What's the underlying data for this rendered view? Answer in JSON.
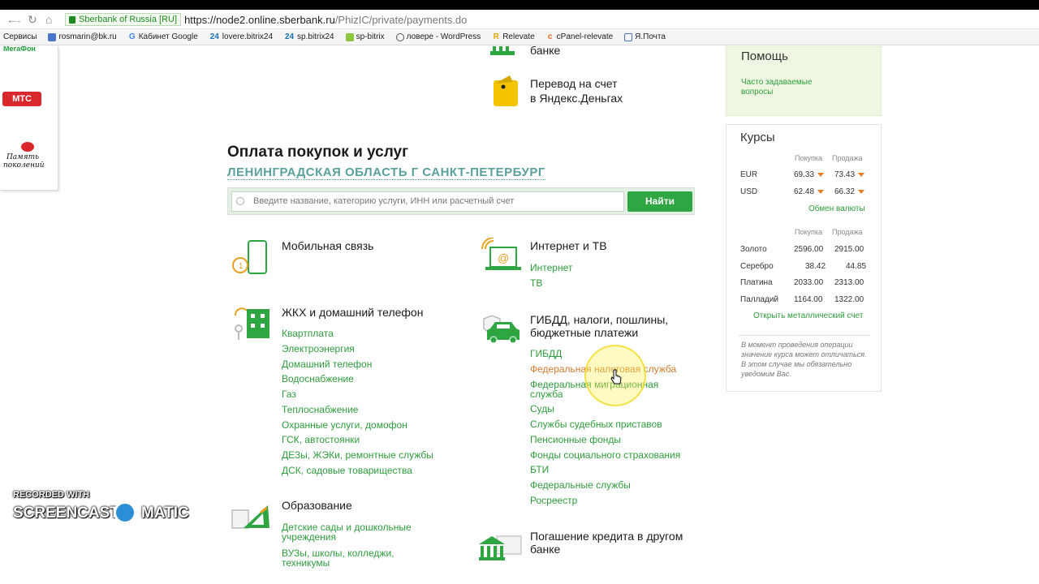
{
  "browser": {
    "secure_label": "Sberbank of Russia [RU]",
    "url_host": "https://node2.online.sberbank.ru",
    "url_path": "/PhizIC/private/payments.do",
    "bookmarks": [
      {
        "label": "Сервисы",
        "icon": "apps-icon"
      },
      {
        "label": "rosmarin@bk.ru",
        "icon": "mail-icon"
      },
      {
        "label": "Кабинет Google",
        "icon": "google-icon"
      },
      {
        "label": "lovere.bitrix24",
        "icon": "bitrix-icon"
      },
      {
        "label": "sp.bitrix24",
        "icon": "bitrix-icon"
      },
      {
        "label": "sp-bitrix",
        "icon": "bitrix-icon"
      },
      {
        "label": "ловере - WordPress",
        "icon": "wordpress-icon"
      },
      {
        "label": "Relevate",
        "icon": "relevate-icon"
      },
      {
        "label": "cPanel-relevate",
        "icon": "cpanel-icon"
      },
      {
        "label": "Я.Почта",
        "icon": "mail-icon"
      }
    ]
  },
  "left_logos": {
    "megafon": "МегаФон",
    "mts": "МТС",
    "pamyat_line1": "Память",
    "pamyat_line2": "поколений"
  },
  "top_items": {
    "bank_tail": "банке",
    "yandex_line1": "Перевод на счет",
    "yandex_line2": "в Яндекс.Деньгах"
  },
  "payments": {
    "title": "Оплата покупок и услуг",
    "region": "ЛЕНИНГРАДСКАЯ ОБЛАСТЬ Г САНКТ-ПЕТЕРБУРГ",
    "search_placeholder": "Введите название, категорию услуги, ИНН или расчетный счет",
    "search_button": "Найти"
  },
  "categories": {
    "mobile": {
      "title": "Мобильная связь"
    },
    "internet": {
      "title": "Интернет и ТВ",
      "links": [
        "Интернет",
        "ТВ"
      ]
    },
    "housing": {
      "title": "ЖКХ и домашний телефон",
      "links": [
        "Квартплата",
        "Электроэнергия",
        "Домашний телефон",
        "Водоснабжение",
        "Газ",
        "Теплоснабжение",
        "Охранные услуги, домофон",
        "ГСК, автостоянки",
        "ДЕЗы, ЖЭКи, ремонтные службы",
        "ДСК, садовые товарищества"
      ]
    },
    "gibdd": {
      "title_line1": "ГИБДД, налоги, пошлины,",
      "title_line2": "бюджетные платежи",
      "links": [
        "ГИБДД",
        "Федеральная налоговая служба",
        "Федеральная миграционная",
        "служба",
        "Суды",
        "Службы судебных приставов",
        "Пенсионные фонды",
        "Фонды социального страхования",
        "БТИ",
        "Федеральные службы",
        "Росреестр"
      ]
    },
    "education": {
      "title": "Образование",
      "links": [
        "Детские сады и дошкольные",
        "учреждения",
        "ВУЗы, школы, колледжи,",
        "техникумы"
      ]
    },
    "credit": {
      "title_line1": "Погашение кредита в другом",
      "title_line2": "банке"
    }
  },
  "help": {
    "title": "Помощь",
    "link_line1": "Часто задаваемые",
    "link_line2": "вопросы"
  },
  "rates": {
    "title": "Курсы",
    "buy_label": "Покупка",
    "sell_label": "Продажа",
    "currencies": [
      {
        "code": "EUR",
        "buy": "69.33",
        "sell": "73.43"
      },
      {
        "code": "USD",
        "buy": "62.48",
        "sell": "66.32"
      }
    ],
    "exchange_link": "Обмен валюты",
    "metals": [
      {
        "name": "Золото",
        "buy": "2596.00",
        "sell": "2915.00"
      },
      {
        "name": "Серебро",
        "buy": "38.42",
        "sell": "44.85"
      },
      {
        "name": "Платина",
        "buy": "2033.00",
        "sell": "2313.00"
      },
      {
        "name": "Палладий",
        "buy": "1164.00",
        "sell": "1322.00"
      }
    ],
    "metal_link": "Открыть металлический счет",
    "note": "В момент проведения операции значение курса может отличаться. В этом случае мы обязательно уведомим Вас."
  },
  "watermark": {
    "line1": "RECORDED WITH",
    "line2": "SCREENCAST",
    "line3": "MATIC"
  },
  "colors": {
    "accent_green": "#2ea642",
    "link_green": "#2e9c3c",
    "highlight_orange": "#d57b30",
    "rate_arrow": "#e87a1e"
  }
}
